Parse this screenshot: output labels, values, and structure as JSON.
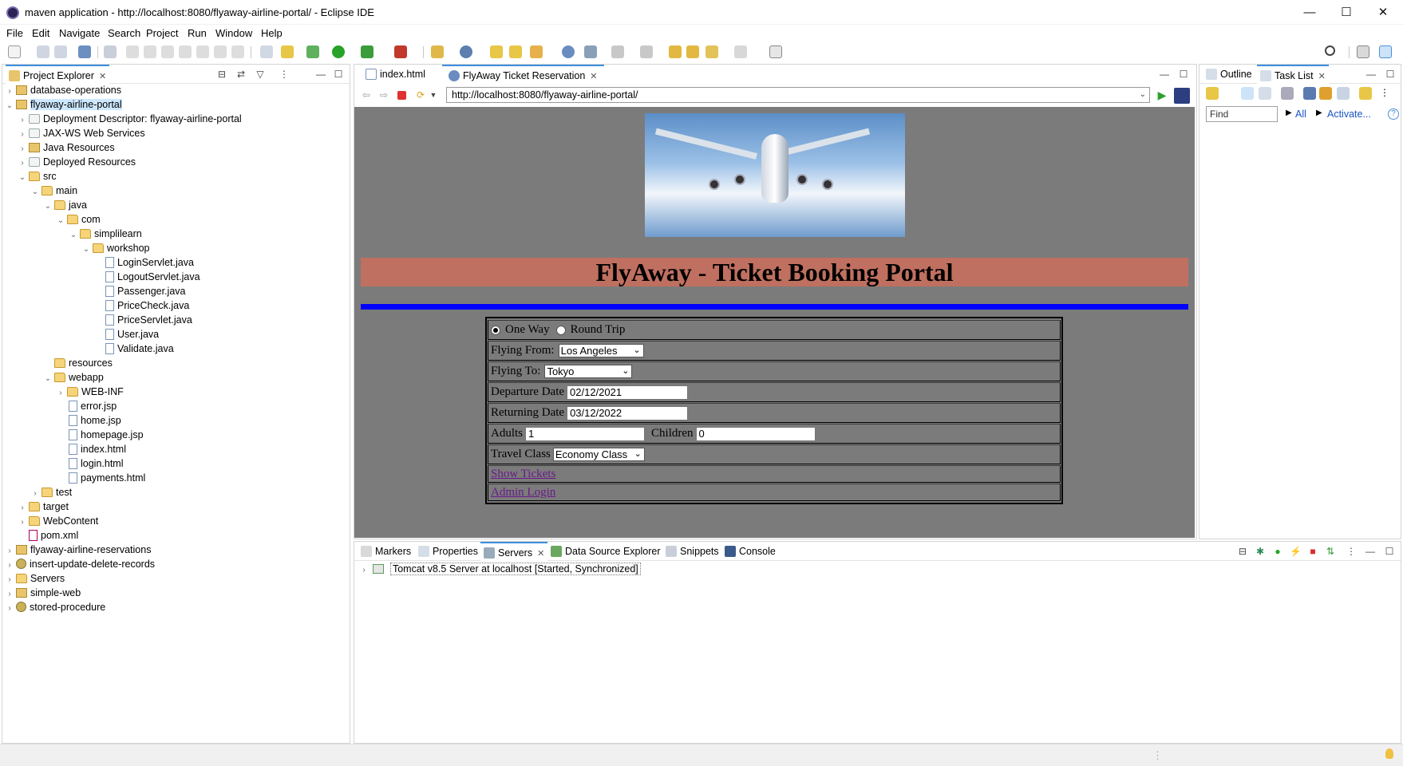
{
  "window": {
    "title": "maven application - http://localhost:8080/flyaway-airline-portal/ - Eclipse IDE",
    "minimize": "—",
    "maximize": "☐",
    "close": "✕"
  },
  "menu": [
    "File",
    "Edit",
    "Navigate",
    "Search",
    "Project",
    "Run",
    "Window",
    "Help"
  ],
  "project_explorer": {
    "tab_label": "Project Explorer",
    "items": [
      "database-operations",
      "flyaway-airline-portal",
      "Deployment Descriptor: flyaway-airline-portal",
      "JAX-WS Web Services",
      "Java Resources",
      "Deployed Resources",
      "src",
      "main",
      "java",
      "com",
      "simplilearn",
      "workshop",
      "LoginServlet.java",
      "LogoutServlet.java",
      "Passenger.java",
      "PriceCheck.java",
      "PriceServlet.java",
      "User.java",
      "Validate.java",
      "resources",
      "webapp",
      "WEB-INF",
      "error.jsp",
      "home.jsp",
      "homepage.jsp",
      "index.html",
      "login.html",
      "payments.html",
      "test",
      "target",
      "WebContent",
      "pom.xml",
      "flyaway-airline-reservations",
      "insert-update-delete-records",
      "Servers",
      "simple-web",
      "stored-procedure"
    ]
  },
  "editor": {
    "tabs": [
      "index.html",
      "FlyAway Ticket Reservation"
    ],
    "url": "http://localhost:8080/flyaway-airline-portal/"
  },
  "page": {
    "heading": "FlyAway - Ticket Booking Portal",
    "one_way": "One Way",
    "round_trip": "Round Trip",
    "flying_from_label": "Flying From:",
    "flying_from_value": "Los Angeles",
    "flying_to_label": "Flying To:",
    "flying_to_value": "Tokyo",
    "departure_label": "Departure Date",
    "departure_value": "02/12/2021",
    "returning_label": "Returning Date",
    "returning_value": "03/12/2022",
    "adults_label": "Adults",
    "adults_value": "1",
    "children_label": "Children",
    "children_value": "0",
    "travel_class_label": "Travel Class",
    "travel_class_value": "Economy Class",
    "show_tickets": "Show Tickets",
    "admin_login": "Admin Login"
  },
  "right_panel": {
    "tabs": [
      "Outline",
      "Task List"
    ],
    "find_placeholder": "Find",
    "all": "All",
    "activate": "Activate..."
  },
  "bottom_panel": {
    "tabs": [
      "Markers",
      "Properties",
      "Servers",
      "Data Source Explorer",
      "Snippets",
      "Console"
    ],
    "server_row": "Tomcat v8.5 Server at localhost  [Started, Synchronized]"
  },
  "colors": {
    "accent": "#3c8fe0",
    "banner": "#c07060",
    "page_bg": "#7b7b7b",
    "blue_rule": "#0000ff",
    "link": "#6a1a8a"
  }
}
